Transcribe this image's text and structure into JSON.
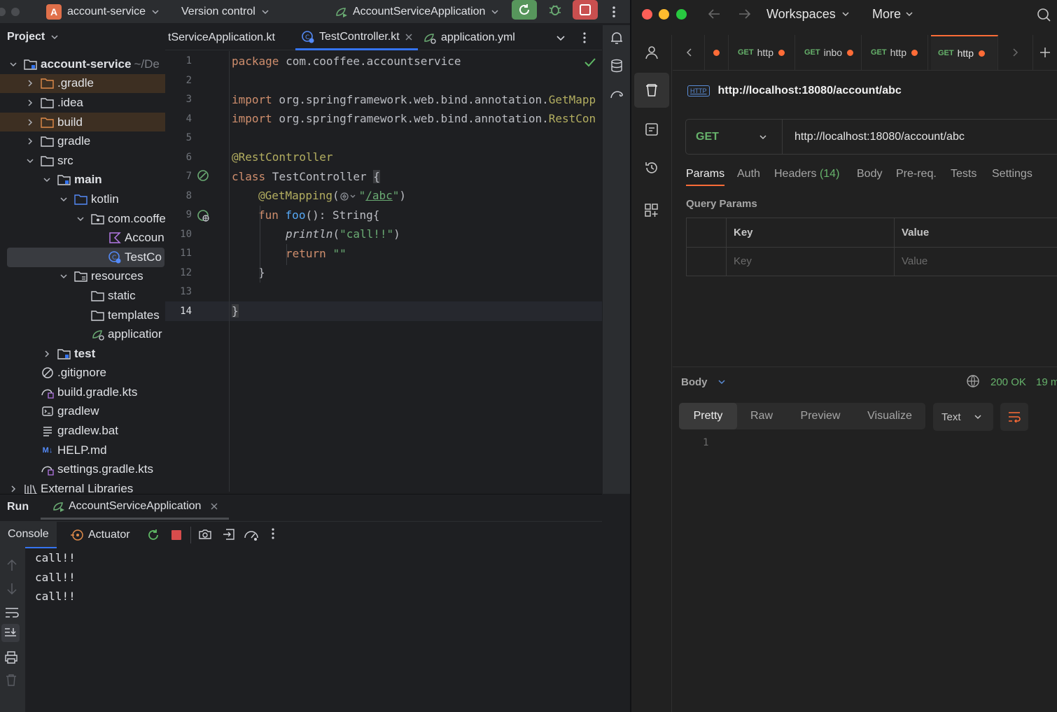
{
  "ide": {
    "project_name": "account-service",
    "project_badge": "A",
    "version_control": "Version control",
    "run_config": "AccountServiceApplication",
    "project_panel_title": "Project",
    "tree": [
      {
        "label": "account-service",
        "suffix": "~/De"
      },
      {
        "label": ".gradle"
      },
      {
        "label": ".idea"
      },
      {
        "label": "build"
      },
      {
        "label": "gradle"
      },
      {
        "label": "src"
      },
      {
        "label": "main"
      },
      {
        "label": "kotlin"
      },
      {
        "label": "com.cooffe"
      },
      {
        "label": "Accoun"
      },
      {
        "label": "TestCo"
      },
      {
        "label": "resources"
      },
      {
        "label": "static"
      },
      {
        "label": "templates"
      },
      {
        "label": "applicatior"
      },
      {
        "label": "test"
      },
      {
        "label": ".gitignore"
      },
      {
        "label": "build.gradle.kts"
      },
      {
        "label": "gradlew"
      },
      {
        "label": "gradlew.bat"
      },
      {
        "label": "HELP.md"
      },
      {
        "label": "settings.gradle.kts"
      },
      {
        "label": "External Libraries"
      }
    ],
    "tabs": [
      {
        "label": "tServiceApplication.kt"
      },
      {
        "label": "TestController.kt"
      },
      {
        "label": "application.yml"
      }
    ],
    "line_numbers": [
      "1",
      "2",
      "3",
      "4",
      "5",
      "6",
      "7",
      "8",
      "9",
      "10",
      "11",
      "12",
      "13",
      "14"
    ],
    "code": {
      "l1_kw": "package",
      "l1_rest": " com.cooffee.accountservice",
      "l3_kw": "import",
      "l3_rest": " org.springframework.web.bind.annotation.",
      "l3_ann": "GetMapp",
      "l4_kw": "import",
      "l4_rest": " org.springframework.web.bind.annotation.",
      "l4_ann": "RestCon",
      "l6_ann": "@RestController",
      "l7_kw": "class",
      "l7_rest": " TestController ",
      "l7_brace": "{",
      "l8_ann": "@GetMapping",
      "l8_open": "(",
      "l8_q1": "\"",
      "l8_path": "/abc",
      "l8_q2": "\"",
      "l8_close": ")",
      "l9_kw": "fun",
      "l9_fn": "foo",
      "l9_rest": "(): String{",
      "l10_fn": "println",
      "l10_open": "(",
      "l10_str": "\"call!!\"",
      "l10_close": ")",
      "l11_kw": "return",
      "l11_str": "\"\"",
      "l12": "}",
      "l14": "}"
    },
    "run_label": "Run",
    "run_tab": "AccountServiceApplication",
    "console_tab": "Console",
    "actuator_tab": "Actuator",
    "output": [
      "call!!",
      "call!!",
      "call!!"
    ]
  },
  "postman": {
    "workspaces": "Workspaces",
    "more": "More",
    "request_tabs": [
      {
        "method": "GET",
        "label": "http"
      },
      {
        "method": "GET",
        "label": "inbo"
      },
      {
        "method": "GET",
        "label": "http"
      },
      {
        "method": "GET",
        "label": "http"
      }
    ],
    "request_title": "http://localhost:18080/account/abc",
    "http_badge": "HTTP",
    "method": "GET",
    "url": "http://localhost:18080/account/abc",
    "subtabs": {
      "params": "Params",
      "auth": "Auth",
      "headers": "Headers",
      "headers_count": "(14)",
      "body": "Body",
      "prereq": "Pre-req.",
      "tests": "Tests",
      "settings": "Settings"
    },
    "query_params_title": "Query Params",
    "col_key": "Key",
    "col_value": "Value",
    "key_placeholder": "Key",
    "value_placeholder": "Value",
    "response_body_label": "Body",
    "status": "200 OK",
    "time": "19 m",
    "views": {
      "pretty": "Pretty",
      "raw": "Raw",
      "preview": "Preview",
      "visualize": "Visualize"
    },
    "format": "Text",
    "response_line": "1"
  },
  "colors": {
    "accent": "#3574f0",
    "postman_orange": "#ff6c37",
    "status_green": "#66b26b",
    "run_green": "#5fb865",
    "stop_red": "#d74c4c"
  }
}
